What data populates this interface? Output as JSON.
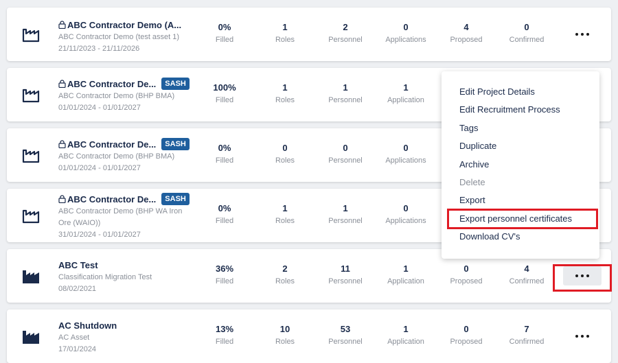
{
  "colors": {
    "accent": "#1f5f9e",
    "title": "#1a2a4a",
    "muted": "#8a8f98",
    "highlight": "#e01b24"
  },
  "projects": [
    {
      "title": "ABC Contractor Demo (A...",
      "locked": true,
      "badge": "",
      "icon": "factory-outline-icon",
      "lines": [
        "ABC Contractor Demo (test asset 1)",
        "21/11/2023 - 21/11/2026"
      ],
      "stats": [
        {
          "value": "0%",
          "label": "Filled"
        },
        {
          "value": "1",
          "label": "Roles"
        },
        {
          "value": "2",
          "label": "Personnel"
        },
        {
          "value": "0",
          "label": "Applications"
        },
        {
          "value": "4",
          "label": "Proposed"
        },
        {
          "value": "0",
          "label": "Confirmed"
        }
      ]
    },
    {
      "title": "ABC Contractor De...",
      "locked": true,
      "badge": "SASH",
      "icon": "factory-outline-icon",
      "lines": [
        "ABC Contractor Demo (BHP BMA)",
        "01/01/2024 - 01/01/2027"
      ],
      "stats": [
        {
          "value": "100%",
          "label": "Filled"
        },
        {
          "value": "1",
          "label": "Roles"
        },
        {
          "value": "1",
          "label": "Personnel"
        },
        {
          "value": "1",
          "label": "Application"
        }
      ]
    },
    {
      "title": "ABC Contractor De...",
      "locked": true,
      "badge": "SASH",
      "icon": "factory-outline-icon",
      "lines": [
        "ABC Contractor Demo (BHP BMA)",
        "01/01/2024 - 01/01/2027"
      ],
      "stats": [
        {
          "value": "0%",
          "label": "Filled"
        },
        {
          "value": "0",
          "label": "Roles"
        },
        {
          "value": "0",
          "label": "Personnel"
        },
        {
          "value": "0",
          "label": "Applications"
        }
      ]
    },
    {
      "title": "ABC Contractor De...",
      "locked": true,
      "badge": "SASH",
      "icon": "factory-outline-icon",
      "lines": [
        "ABC Contractor Demo (BHP WA Iron",
        "Ore (WAIO))",
        "31/01/2024 - 01/01/2027"
      ],
      "stats": [
        {
          "value": "0%",
          "label": "Filled"
        },
        {
          "value": "1",
          "label": "Roles"
        },
        {
          "value": "1",
          "label": "Personnel"
        },
        {
          "value": "0",
          "label": "Applications"
        }
      ]
    },
    {
      "title": "ABC Test",
      "locked": false,
      "badge": "",
      "icon": "factory-filled-icon",
      "lines": [
        "Classification Migration Test",
        "08/02/2021"
      ],
      "stats": [
        {
          "value": "36%",
          "label": "Filled"
        },
        {
          "value": "2",
          "label": "Roles"
        },
        {
          "value": "11",
          "label": "Personnel"
        },
        {
          "value": "1",
          "label": "Application"
        },
        {
          "value": "0",
          "label": "Proposed"
        },
        {
          "value": "4",
          "label": "Confirmed"
        }
      ]
    },
    {
      "title": "AC Shutdown",
      "locked": false,
      "badge": "",
      "icon": "factory-filled-icon",
      "lines": [
        "AC Asset",
        "17/01/2024"
      ],
      "stats": [
        {
          "value": "13%",
          "label": "Filled"
        },
        {
          "value": "10",
          "label": "Roles"
        },
        {
          "value": "53",
          "label": "Personnel"
        },
        {
          "value": "1",
          "label": "Application"
        },
        {
          "value": "0",
          "label": "Proposed"
        },
        {
          "value": "7",
          "label": "Confirmed"
        }
      ]
    }
  ],
  "menu": {
    "items": [
      {
        "label": "Edit Project Details",
        "enabled": true
      },
      {
        "label": "Edit Recruitment Process",
        "enabled": true
      },
      {
        "label": "Tags",
        "enabled": true
      },
      {
        "label": "Duplicate",
        "enabled": true
      },
      {
        "label": "Archive",
        "enabled": true
      },
      {
        "label": "Delete",
        "enabled": false
      },
      {
        "label": "Export",
        "enabled": true
      },
      {
        "label": "Export personnel certificates",
        "enabled": true
      },
      {
        "label": "Download CV's",
        "enabled": true
      }
    ]
  }
}
